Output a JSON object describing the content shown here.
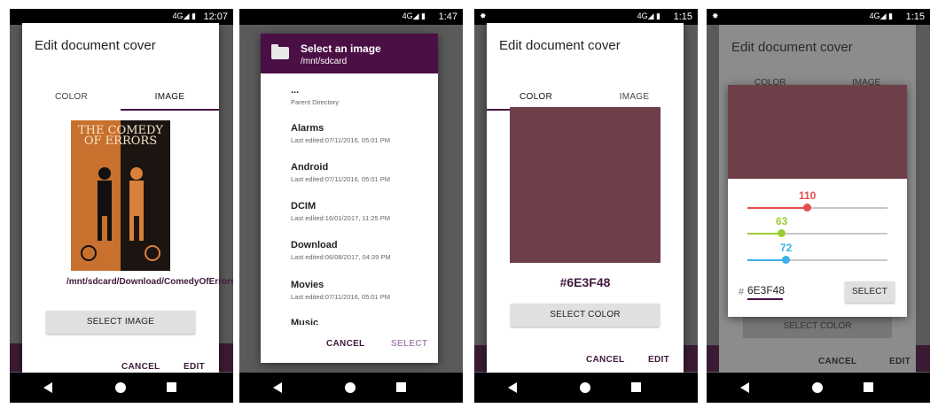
{
  "colors": {
    "accent": "#4a1444",
    "swatch": "#6E3F48",
    "red": "#e84c4c",
    "green": "#9acd32",
    "blue": "#3ab0e8"
  },
  "screen1": {
    "status_time": "12:07",
    "title": "Edit document cover",
    "tabs": [
      "COLOR",
      "IMAGE"
    ],
    "active_tab": "IMAGE",
    "book_title": "THE COMEDY OF ERRORS",
    "file_path": "/mnt/sdcard/Download/ComedyOfErrors.jpg",
    "select_button": "SELECT IMAGE",
    "cancel": "CANCEL",
    "edit": "EDIT"
  },
  "screen2": {
    "status_time": "1:47",
    "header_title": "Select an image",
    "header_path": "/mnt/sdcard",
    "items": [
      {
        "name": "...",
        "meta": "Parent Directory"
      },
      {
        "name": "Alarms",
        "meta": "Last edited:07/11/2016, 05:01 PM"
      },
      {
        "name": "Android",
        "meta": "Last edited:07/11/2016, 05:01 PM"
      },
      {
        "name": "DCIM",
        "meta": "Last edited:16/01/2017, 11:25 PM"
      },
      {
        "name": "Download",
        "meta": "Last edited:06/08/2017, 04:39 PM"
      },
      {
        "name": "Movies",
        "meta": "Last edited:07/11/2016, 05:01 PM"
      },
      {
        "name": "Music",
        "meta": ""
      }
    ],
    "cancel": "CANCEL",
    "select": "SELECT"
  },
  "screen3": {
    "status_time": "1:15",
    "title": "Edit document cover",
    "tabs": [
      "COLOR",
      "IMAGE"
    ],
    "active_tab": "COLOR",
    "hex": "#6E3F48",
    "select_button": "SELECT COLOR",
    "cancel": "CANCEL",
    "edit": "EDIT"
  },
  "screen4": {
    "status_time": "1:15",
    "title": "Edit document cover",
    "tabs_behind": [
      "COLOR",
      "IMAGE"
    ],
    "select_color_behind": "SELECT COLOR",
    "red": 110,
    "green": 63,
    "blue": 72,
    "hash": "#",
    "hex_value": "6E3F48",
    "select": "SELECT",
    "cancel": "CANCEL",
    "edit": "EDIT"
  }
}
